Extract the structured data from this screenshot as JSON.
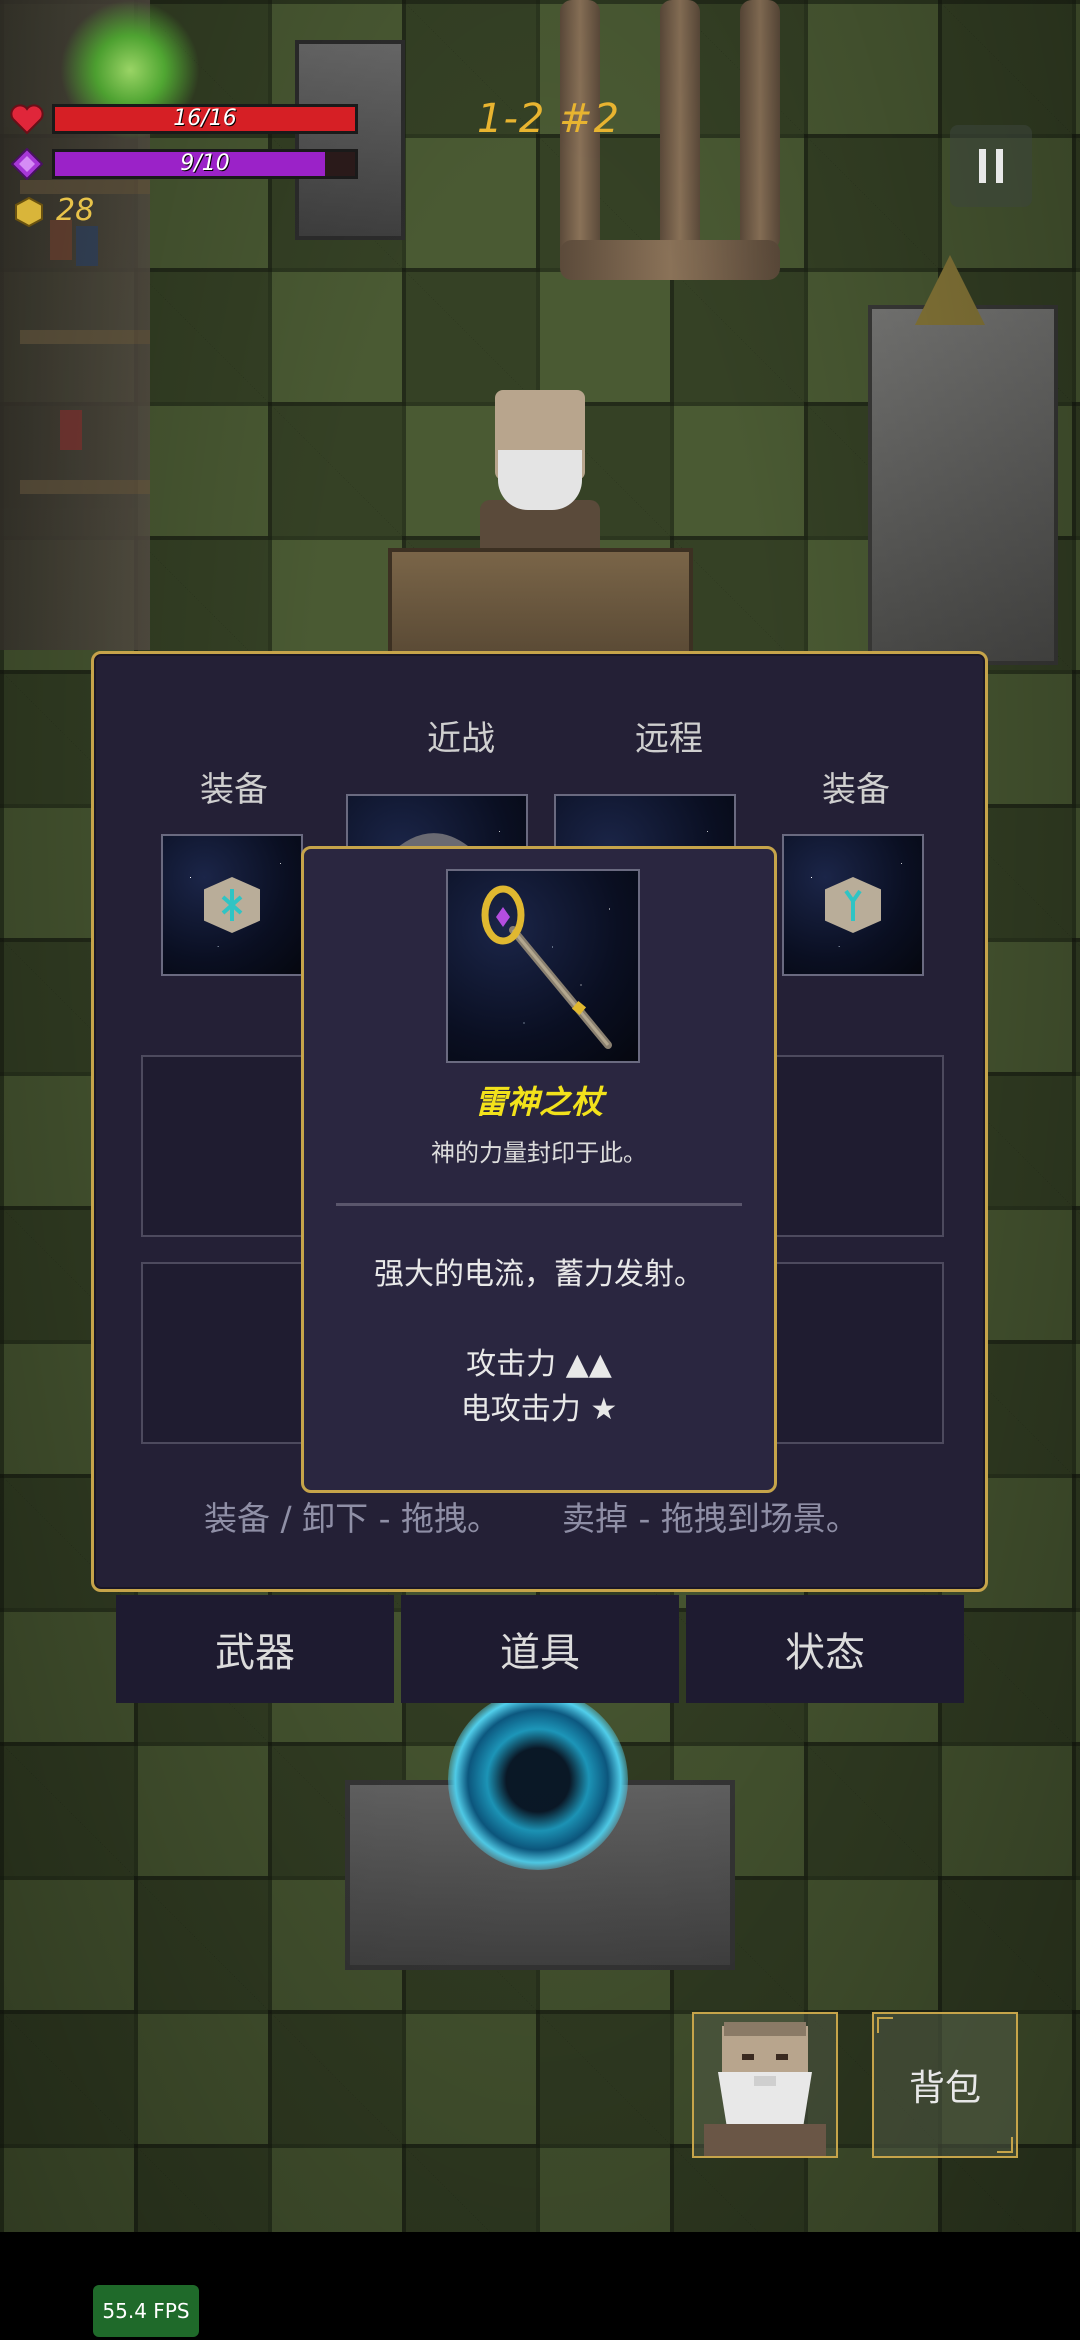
{
  "hud": {
    "hp": {
      "current": 16,
      "max": 16,
      "text": "16/16",
      "color": "#d61f25"
    },
    "mana": {
      "current": 9,
      "max": 10,
      "text": "9/10",
      "color": "#9b22c8"
    },
    "coins": "28",
    "level": "1-2 #2"
  },
  "equipment": {
    "melee_label": "近战",
    "ranged_label": "远程",
    "left_equip_label": "装备",
    "right_equip_label": "装备"
  },
  "tooltip": {
    "name": "雷神之杖",
    "flavor": "神的力量封印于此。",
    "description": "强大的电流，蓄力发射。",
    "stat_attack": "攻击力 ▲▲",
    "stat_electric": "电攻击力 ★"
  },
  "hints": {
    "equip": "装备 / 卸下 - 拖拽。",
    "sell": "卖掉 - 拖拽到场景。"
  },
  "tabs": [
    {
      "label": "武器"
    },
    {
      "label": "道具"
    },
    {
      "label": "状态"
    }
  ],
  "buttons": {
    "backpack": "背包"
  },
  "fps": "55.4 FPS",
  "colors": {
    "panel_bg": "#242036",
    "panel_border": "#c6a44a",
    "item_name": "#f2e21b",
    "rune_glow": "#2fc4c4"
  }
}
